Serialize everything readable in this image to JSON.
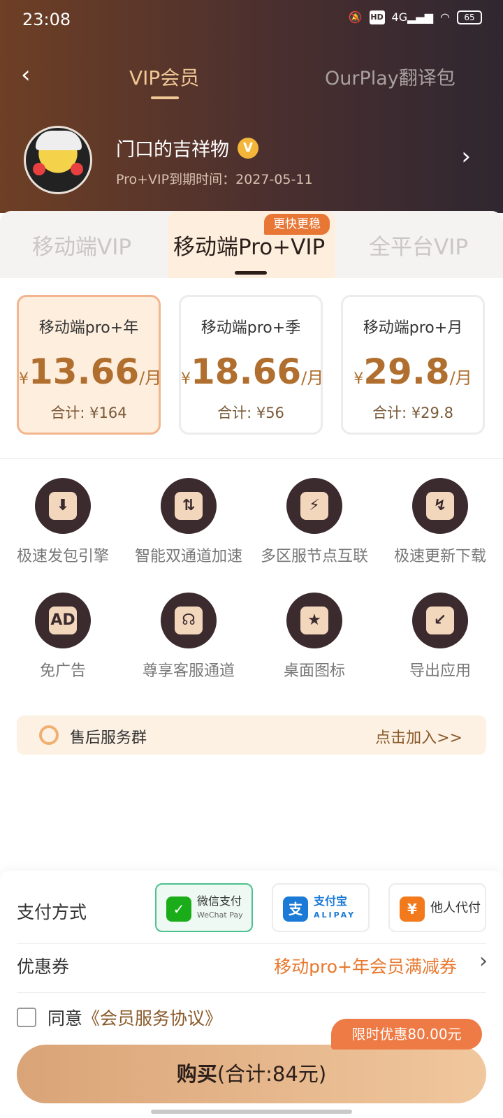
{
  "status": {
    "time": "23:08",
    "network": "4G",
    "battery": "65",
    "hd": "HD"
  },
  "nav": {
    "tab_vip": "VIP会员",
    "tab_translate": "OurPlay翻译包"
  },
  "profile": {
    "username": "门口的吉祥物",
    "vip_badge": "V",
    "expiry": "Pro+VIP到期时间：2027-05-11"
  },
  "tiers": {
    "mobile_vip": "移动端VIP",
    "mobile_pro": "移动端Pro+VIP",
    "all_platform": "全平台VIP",
    "badge": "更快更稳"
  },
  "plans": [
    {
      "name": "移动端pro+年",
      "currency": "¥",
      "price": "13.66",
      "unit": "/月",
      "total": "合计: ¥164"
    },
    {
      "name": "移动端pro+季",
      "currency": "¥",
      "price": "18.66",
      "unit": "/月",
      "total": "合计: ¥56"
    },
    {
      "name": "移动端pro+月",
      "currency": "¥",
      "price": "29.8",
      "unit": "/月",
      "total": "合计: ¥29.8"
    }
  ],
  "features": [
    {
      "label": "极速发包引擎",
      "icon": "download-boost-icon",
      "glyph": "⬇"
    },
    {
      "label": "智能双通道加速",
      "icon": "dual-channel-icon",
      "glyph": "⇅"
    },
    {
      "label": "多区服节点互联",
      "icon": "node-link-icon",
      "glyph": "⚡"
    },
    {
      "label": "极速更新下载",
      "icon": "update-download-icon",
      "glyph": "↯"
    },
    {
      "label": "免广告",
      "icon": "no-ads-icon",
      "glyph": "AD"
    },
    {
      "label": "尊享客服通道",
      "icon": "headset-icon",
      "glyph": "☊"
    },
    {
      "label": "桌面图标",
      "icon": "star-icon",
      "glyph": "★"
    },
    {
      "label": "导出应用",
      "icon": "export-folder-icon",
      "glyph": "↙"
    }
  ],
  "aftersale": {
    "label": "售后服务群",
    "action": "点击加入>>"
  },
  "payment": {
    "label": "支付方式",
    "wechat": {
      "cn": "微信支付",
      "en": "WeChat Pay"
    },
    "alipay": {
      "cn": "支付宝",
      "en": "ALIPAY"
    },
    "other": "他人代付"
  },
  "coupon": {
    "label": "优惠券",
    "value": "移动pro+年会员满减券"
  },
  "agreement": {
    "prefix": "同意",
    "link": "《会员服务协议》"
  },
  "promo": "限时优惠80.00元",
  "buy": {
    "label": "购买",
    "total": "(合计:84元)"
  },
  "colors": {
    "accent": "#b06f2f",
    "promo": "#ee7b45",
    "wechat": "#4cc08e",
    "alipay": "#1a7ad6"
  }
}
